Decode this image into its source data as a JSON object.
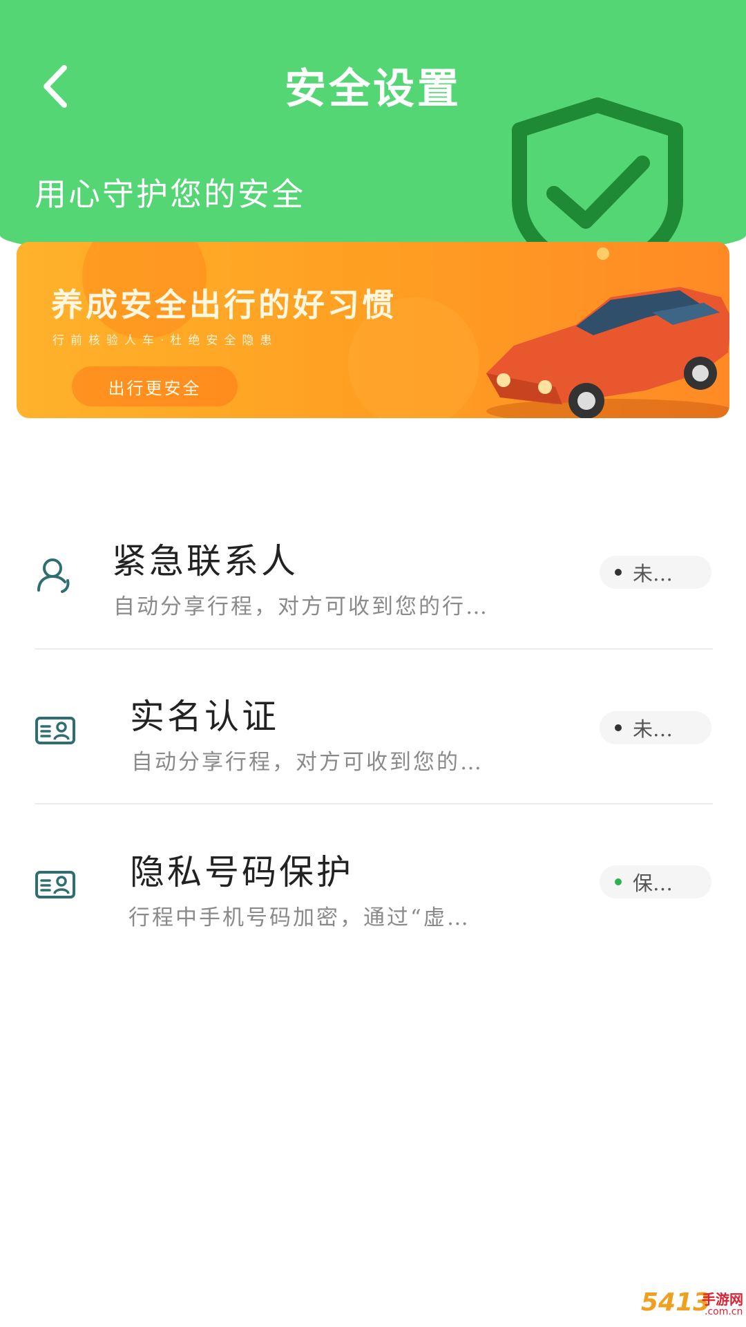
{
  "header": {
    "title": "安全设置",
    "subtitle": "用心守护您的安全",
    "back_icon": "chevron-left-icon",
    "shield_icon": "shield-check-icon",
    "background_color": "#55d675",
    "shield_color": "#1e8a35"
  },
  "banner": {
    "title": "养成安全出行的好习惯",
    "subtitle": "行前核验人车·杜绝安全隐患",
    "button_label": "出行更安全",
    "gradient_start": "#ffb22b",
    "gradient_end": "#ff8a25"
  },
  "items": [
    {
      "icon": "user-contact-icon",
      "title": "紧急联系人",
      "description": "自动分享行程，对方可收到您的行…",
      "status": "未…",
      "status_color": "#333333"
    },
    {
      "icon": "id-card-icon",
      "title": "实名认证",
      "description": "自动分享行程，对方可收到您的…",
      "status": "未…",
      "status_color": "#333333"
    },
    {
      "icon": "id-card-icon",
      "title": "隐私号码保护",
      "description": "行程中手机号码加密，通过“虚…",
      "status": "保…",
      "status_color": "#2fb24c"
    }
  ],
  "watermark": {
    "logo_number": "5413",
    "text": "手游网",
    "domain": ".com.cn"
  }
}
